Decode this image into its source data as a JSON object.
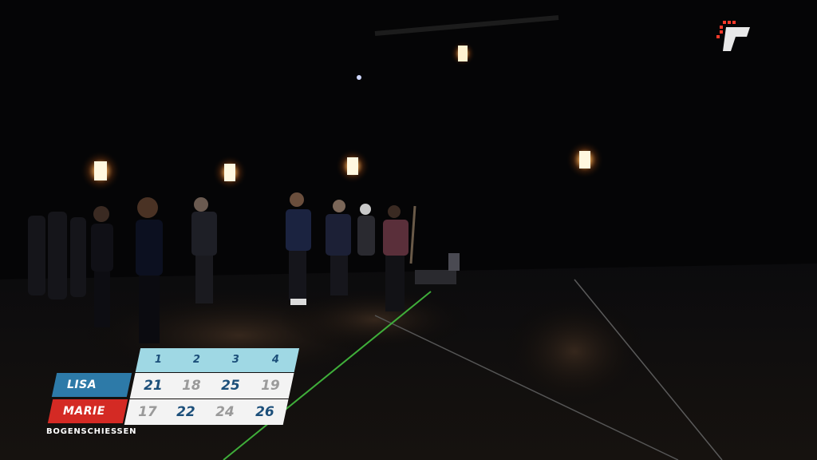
{
  "broadcast": {
    "caption": "BOGENSCHIESSEN",
    "players": [
      {
        "name": "LISA",
        "color": "#2d7aa8"
      },
      {
        "name": "MARIE",
        "color": "#d42a24"
      }
    ],
    "rounds": [
      {
        "label": "1",
        "lisa": "21",
        "marie": "17",
        "winner": "lisa"
      },
      {
        "label": "2",
        "lisa": "18",
        "marie": "22",
        "winner": "marie"
      },
      {
        "label": "3",
        "lisa": "25",
        "marie": "24",
        "winner": "lisa"
      },
      {
        "label": "4",
        "lisa": "19",
        "marie": "26",
        "winner": "marie"
      }
    ],
    "round_header_color": "#9fd8e4",
    "score_win_color": "#1c4f7a",
    "score_lose_color": "#9a9a9a"
  },
  "logo": {
    "icon": "prosieben-logo-icon"
  }
}
